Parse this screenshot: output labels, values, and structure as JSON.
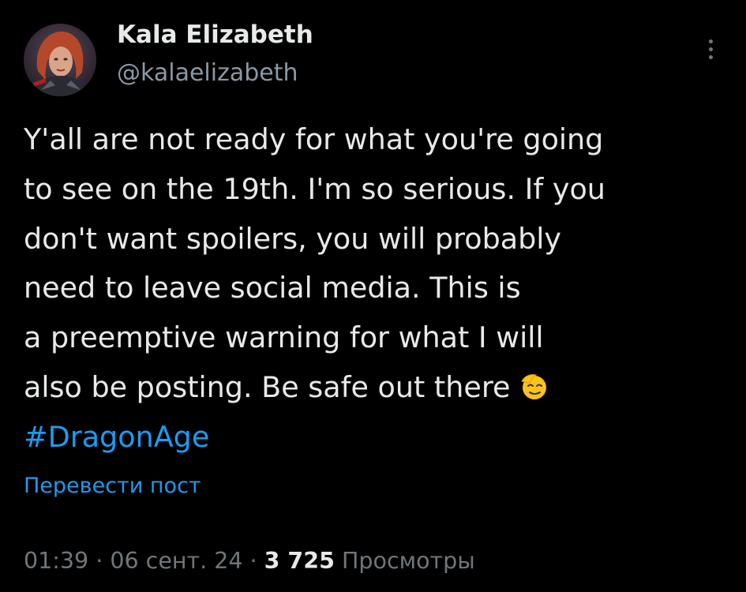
{
  "author": {
    "display_name": "Kala Elizabeth",
    "handle": "@kalaelizabeth",
    "avatar_icon": "avatar-icon"
  },
  "tweet": {
    "lines": [
      "Y'all are not ready for what you're going",
      "to see on the 19th. I'm so serious. If you",
      "don't want spoilers, you will probably",
      "need to leave social media. This is",
      "a preemptive warning for what I will",
      "also be posting. Be safe out there"
    ],
    "emoji": "salute-emoji",
    "hashtag": "#DragonAge"
  },
  "translate_label": "Перевести пост",
  "meta": {
    "time": "01:39",
    "separator": "·",
    "date": "06 сент. 24",
    "views_count": "3 725",
    "views_label": "Просмотры"
  },
  "colors": {
    "background": "#000000",
    "text": "#e7e9ea",
    "secondary": "#8b98a5",
    "link": "#1d9bf0"
  },
  "icons": {
    "more": "more-vertical-icon"
  }
}
